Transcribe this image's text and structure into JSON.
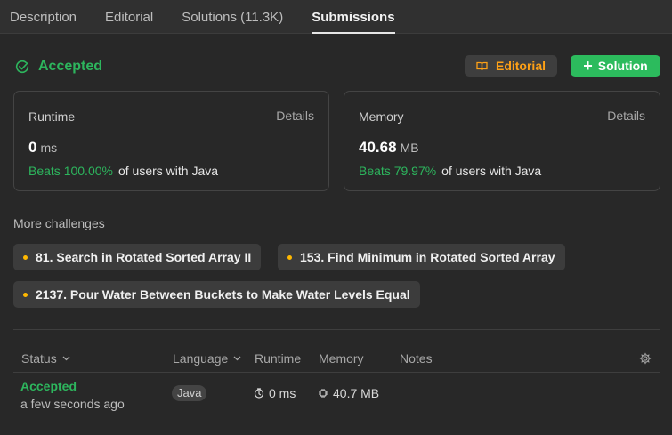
{
  "tabs": [
    {
      "label": "Description"
    },
    {
      "label": "Editorial"
    },
    {
      "label": "Solutions (11.3K)"
    },
    {
      "label": "Submissions",
      "active": true
    }
  ],
  "result": {
    "status": "Accepted",
    "status_color": "#2db55d",
    "editorial_button": "Editorial",
    "solution_button": "Solution"
  },
  "runtime_card": {
    "label": "Runtime",
    "details": "Details",
    "value": "0",
    "unit": "ms",
    "beats_pct": "Beats 100.00%",
    "beats_rest": "of users with Java"
  },
  "memory_card": {
    "label": "Memory",
    "details": "Details",
    "value": "40.68",
    "unit": "MB",
    "beats_pct": "Beats 79.97%",
    "beats_rest": "of users with Java"
  },
  "challenges": {
    "title": "More challenges",
    "items": [
      {
        "label": "81. Search in Rotated Sorted Array II"
      },
      {
        "label": "153. Find Minimum in Rotated Sorted Array"
      },
      {
        "label": "2137. Pour Water Between Buckets to Make Water Levels Equal"
      }
    ]
  },
  "table": {
    "headers": {
      "status": "Status",
      "language": "Language",
      "runtime": "Runtime",
      "memory": "Memory",
      "notes": "Notes"
    },
    "rows": [
      {
        "status": "Accepted",
        "time": "a few seconds ago",
        "language": "Java",
        "runtime": "0 ms",
        "memory": "40.7 MB"
      }
    ]
  },
  "colors": {
    "accent_green": "#2cbb5d",
    "accent_orange": "#ffa116",
    "background": "#282828"
  },
  "icons": [
    "check-circle-icon",
    "book-icon",
    "plus-icon",
    "chevron-down-icon",
    "gear-icon",
    "clock-icon",
    "chip-icon"
  ]
}
